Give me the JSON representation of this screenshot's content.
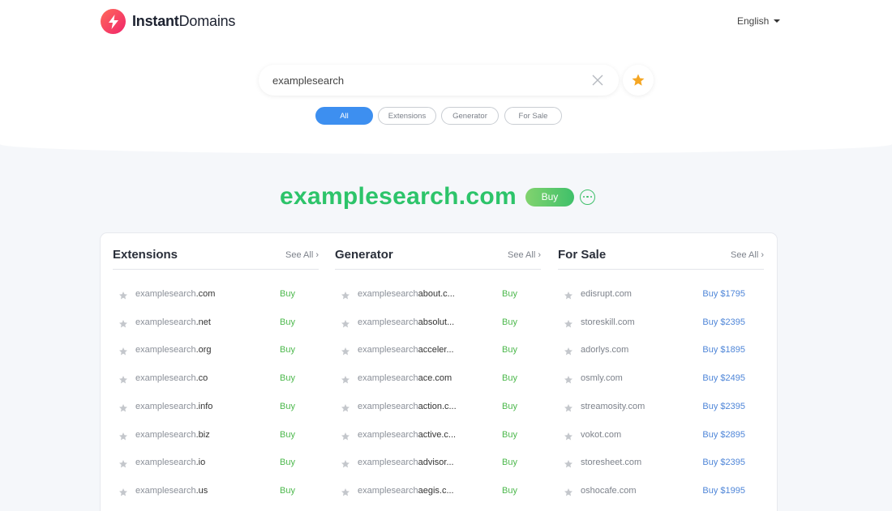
{
  "brand": {
    "name_bold": "Instant",
    "name_light": "Domains"
  },
  "language": {
    "label": "English"
  },
  "search": {
    "value": "examplesearch",
    "placeholder": ""
  },
  "tabs": [
    {
      "label": "All",
      "active": true
    },
    {
      "label": "Extensions",
      "active": false
    },
    {
      "label": "Generator",
      "active": false
    },
    {
      "label": "For Sale",
      "active": false
    }
  ],
  "hero": {
    "domain": "examplesearch.com",
    "buy_label": "Buy"
  },
  "columns": {
    "extensions": {
      "title": "Extensions",
      "see_all": "See All",
      "rows": [
        {
          "base": "examplesearch",
          "suffix": ".com",
          "action": "Buy"
        },
        {
          "base": "examplesearch",
          "suffix": ".net",
          "action": "Buy"
        },
        {
          "base": "examplesearch",
          "suffix": ".org",
          "action": "Buy"
        },
        {
          "base": "examplesearch",
          "suffix": ".co",
          "action": "Buy"
        },
        {
          "base": "examplesearch",
          "suffix": ".info",
          "action": "Buy"
        },
        {
          "base": "examplesearch",
          "suffix": ".biz",
          "action": "Buy"
        },
        {
          "base": "examplesearch",
          "suffix": ".io",
          "action": "Buy"
        },
        {
          "base": "examplesearch",
          "suffix": ".us",
          "action": "Buy"
        }
      ]
    },
    "generator": {
      "title": "Generator",
      "see_all": "See All",
      "rows": [
        {
          "base": "examplesearch",
          "suffix": "about.c...",
          "action": "Buy"
        },
        {
          "base": "examplesearch",
          "suffix": "absolut...",
          "action": "Buy"
        },
        {
          "base": "examplesearch",
          "suffix": "acceler...",
          "action": "Buy"
        },
        {
          "base": "examplesearch",
          "suffix": "ace.com",
          "action": "Buy"
        },
        {
          "base": "examplesearch",
          "suffix": "action.c...",
          "action": "Buy"
        },
        {
          "base": "examplesearch",
          "suffix": "active.c...",
          "action": "Buy"
        },
        {
          "base": "examplesearch",
          "suffix": "advisor...",
          "action": "Buy"
        },
        {
          "base": "examplesearch",
          "suffix": "aegis.c...",
          "action": "Buy"
        }
      ]
    },
    "forsale": {
      "title": "For Sale",
      "see_all": "See All",
      "rows": [
        {
          "name": "edisrupt.com",
          "action": "Buy $1795"
        },
        {
          "name": "storeskill.com",
          "action": "Buy $2395"
        },
        {
          "name": "adorlys.com",
          "action": "Buy $1895"
        },
        {
          "name": "osmly.com",
          "action": "Buy $2495"
        },
        {
          "name": "streamosity.com",
          "action": "Buy $2395"
        },
        {
          "name": "vokot.com",
          "action": "Buy $2895"
        },
        {
          "name": "storesheet.com",
          "action": "Buy $2395"
        },
        {
          "name": "oshocafe.com",
          "action": "Buy $1995"
        }
      ]
    }
  },
  "colors": {
    "accent_blue": "#3d8ff0",
    "domain_green": "#2dc46a",
    "buy_green": "#4cb84c",
    "price_blue": "#4f86d8",
    "favorite_star": "#f5a623",
    "brand_gradient_start": "#ff6a5a",
    "brand_gradient_end": "#f0246b"
  },
  "icons": {
    "brand": "lightning-bolt-icon",
    "favorites": "star-icon",
    "clear": "close-icon",
    "row_favorite": "star-icon",
    "see_all": "chevron-right-icon",
    "more": "more-dots-icon"
  }
}
